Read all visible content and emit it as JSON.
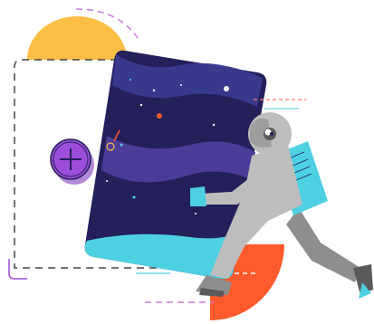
{
  "palette": {
    "yellow": "#FDBE46",
    "orange": "#FF5A2C",
    "navy": "#24205A",
    "wave_blue": "#3A3A8F",
    "wave_purple": "#4A3C98",
    "teal": "#4DD0E1",
    "purple": "#9C4EDB",
    "gray_light": "#BDBDBD",
    "gray_mid": "#8E8E8E",
    "gray_dark": "#5A5A5A",
    "dash_gray": "#444444",
    "lilac": "#C77DDB",
    "coral": "#FF7A6B"
  },
  "icons": {
    "add": "plus-circle-icon",
    "astronaut": "astronaut-illustration"
  }
}
